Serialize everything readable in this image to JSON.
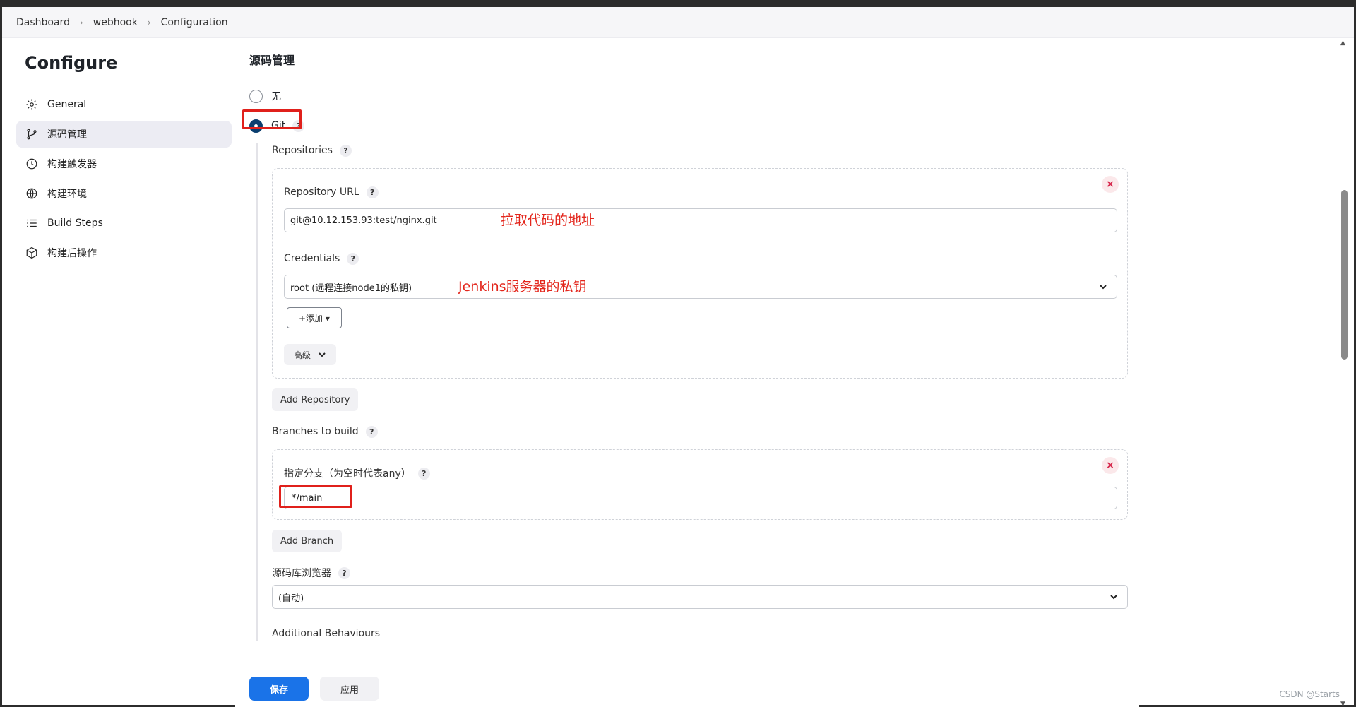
{
  "breadcrumb": [
    "Dashboard",
    "webhook",
    "Configuration"
  ],
  "sidebar": {
    "title": "Configure",
    "items": [
      {
        "label": "General",
        "icon": "gear-icon"
      },
      {
        "label": "源码管理",
        "icon": "branch-icon",
        "active": true
      },
      {
        "label": "构建触发器",
        "icon": "clock-icon"
      },
      {
        "label": "构建环境",
        "icon": "globe-icon"
      },
      {
        "label": "Build Steps",
        "icon": "list-icon"
      },
      {
        "label": "构建后操作",
        "icon": "package-icon"
      }
    ]
  },
  "scm": {
    "section_title": "源码管理",
    "option_none": "无",
    "option_git": "Git",
    "help": "?",
    "repositories_label": "Repositories",
    "repo_url_label": "Repository URL",
    "repo_url_value": "git@10.12.153.93:test/nginx.git",
    "credentials_label": "Credentials",
    "credentials_value": "root (远程连接node1的私钥)",
    "add_button": "+添加 ▾",
    "advanced_button": "高级",
    "add_repository": "Add Repository",
    "branches_label": "Branches to build",
    "branch_spec_label": "指定分支（为空时代表any）",
    "branch_spec_value": "*/main",
    "add_branch": "Add Branch",
    "repo_browser_label": "源码库浏览器",
    "repo_browser_value": "(自动)",
    "additional_behaviours": "Additional Behaviours",
    "remove": "×"
  },
  "annotations": {
    "url_note": "拉取代码的地址",
    "cred_note": "Jenkins服务器的私钥"
  },
  "footer": {
    "save": "保存",
    "apply": "应用"
  },
  "watermark": "CSDN @Starts_",
  "colors": {
    "primary": "#1a73e8",
    "highlight": "#e0201b",
    "radio_checked": "#0b3e6f"
  }
}
